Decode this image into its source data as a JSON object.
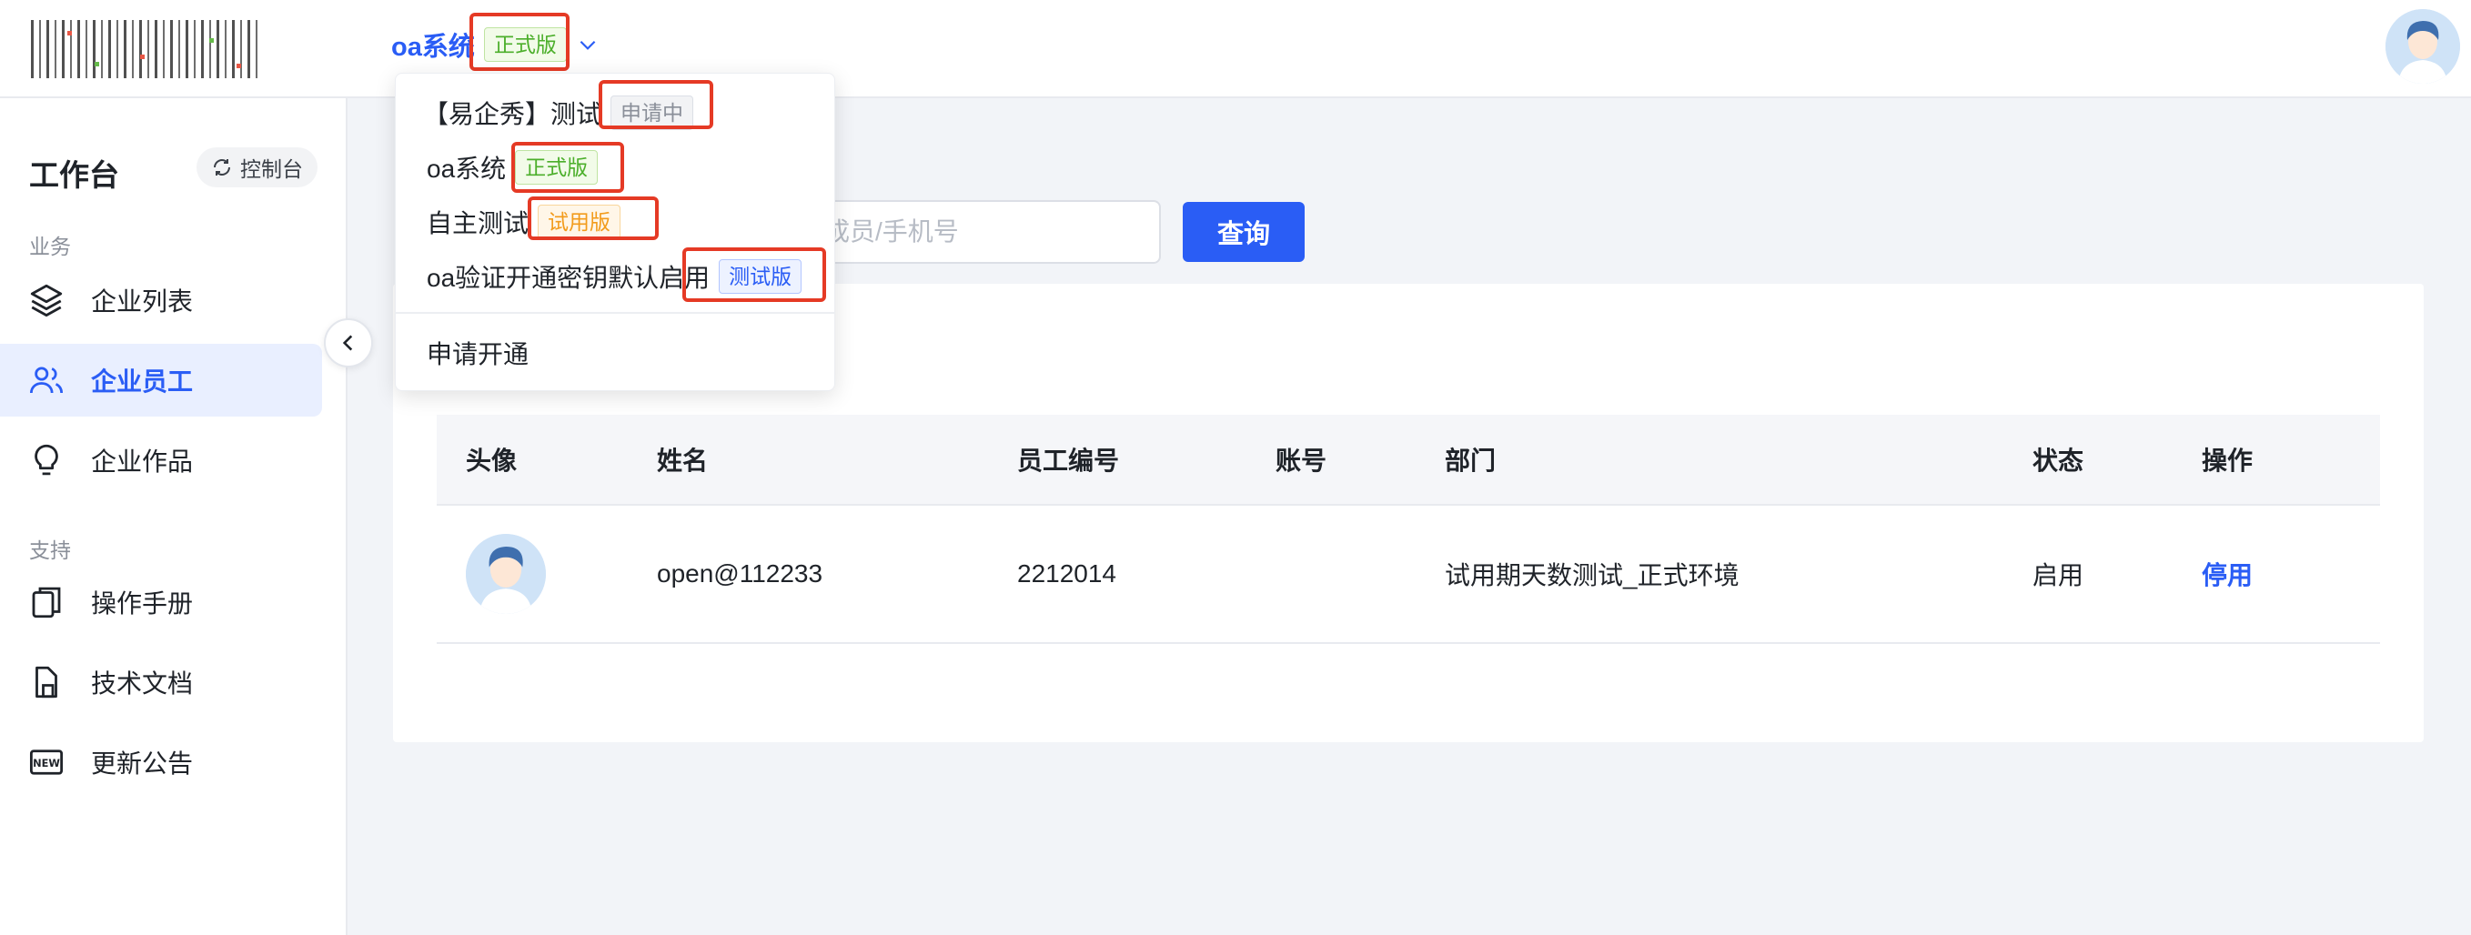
{
  "header": {
    "app_name": "oa系统",
    "app_tag": "正式版"
  },
  "dropdown": {
    "items": [
      {
        "name": "【易企秀】测试",
        "tag": "申请中"
      },
      {
        "name": "oa系统",
        "tag": "正式版"
      },
      {
        "name": "自主测试",
        "tag": "试用版"
      },
      {
        "name": "oa验证开通密钥默认启用",
        "tag": "测试版"
      }
    ],
    "apply_label": "申请开通"
  },
  "sidebar": {
    "title": "工作台",
    "console_label": "控制台",
    "section_business": "业务",
    "section_support": "支持",
    "items": [
      {
        "label": "企业列表",
        "icon": "layers-icon"
      },
      {
        "label": "企业员工",
        "icon": "users-icon"
      },
      {
        "label": "企业作品",
        "icon": "lightbulb-icon"
      },
      {
        "label": "操作手册",
        "icon": "copy-icon"
      },
      {
        "label": "技术文档",
        "icon": "document-icon"
      },
      {
        "label": "更新公告",
        "icon": "new-badge-icon"
      }
    ]
  },
  "search": {
    "placeholder_visible": "成员/手机号",
    "button_label": "查询"
  },
  "card": {
    "title_tail": ")"
  },
  "table": {
    "headers": [
      "头像",
      "姓名",
      "员工编号",
      "账号",
      "部门",
      "状态",
      "操作"
    ],
    "rows": [
      {
        "name": "open@112233",
        "employee_no": "2212014",
        "account": "",
        "department": "试用期天数测试_正式环境",
        "status": "启用",
        "action": "停用"
      }
    ]
  },
  "colors": {
    "primary": "#2a5df5",
    "highlight_box": "#e53a25",
    "tag_green": "#4caf2b",
    "tag_orange": "#f29b1b"
  }
}
